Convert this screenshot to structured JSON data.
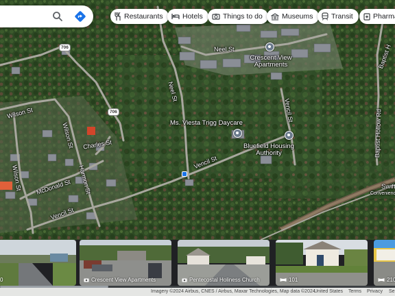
{
  "search": {
    "search_icon": "search-icon",
    "directions_icon": "directions-icon"
  },
  "chips": [
    {
      "label": "Restaurants",
      "icon": "fork-knife-icon"
    },
    {
      "label": "Hotels",
      "icon": "bed-icon"
    },
    {
      "label": "Things to do",
      "icon": "camera-icon"
    },
    {
      "label": "Museums",
      "icon": "museum-icon"
    },
    {
      "label": "Transit",
      "icon": "train-icon"
    },
    {
      "label": "Pharma",
      "icon": "pharmacy-icon"
    }
  ],
  "map": {
    "streets": {
      "neel_top": "Neel St",
      "neel_mid": "Neel St",
      "vencil_mid": "Vencil St",
      "vencil_right": "Vencil St",
      "vencil_left": "Vencil St",
      "wilson_h": "Wilson St",
      "wilson_v": "Wilson St",
      "wilson_v2": "Wilson St",
      "charles": "Charles St",
      "harmon": "Harmon St",
      "mcdonald": "McDonald St",
      "baptist_hollow": "Baptist Hollow Rd",
      "baptist_top": "Baptist H"
    },
    "route_shields": [
      "706",
      "706"
    ],
    "pois": {
      "crescent": "Crescent View Apartments",
      "daycare": "Ms. Viesta Trigg Daycare",
      "bluefield": "Bluefield Housing Authority",
      "swift": "Swift",
      "swift_sub": "Convenienc"
    }
  },
  "streetview": [
    {
      "caption": "0",
      "icon": "none"
    },
    {
      "caption": "Crescent View Apartments",
      "icon": "camera-icon"
    },
    {
      "caption": "Pentecostal Holiness Church",
      "icon": "camera-icon"
    },
    {
      "caption": "101",
      "icon": "panorama-icon"
    },
    {
      "caption": "210",
      "icon": "panorama-icon"
    }
  ],
  "footer": {
    "attribution": "Imagery ©2024 Airbus, CNES / Airbus, Maxar Technologies, Map data ©2024",
    "country": "United States",
    "terms": "Terms",
    "privacy": "Privacy",
    "send": "Se"
  },
  "colors": {
    "accent": "#1a73e8",
    "chip_bg": "#ffffff"
  }
}
